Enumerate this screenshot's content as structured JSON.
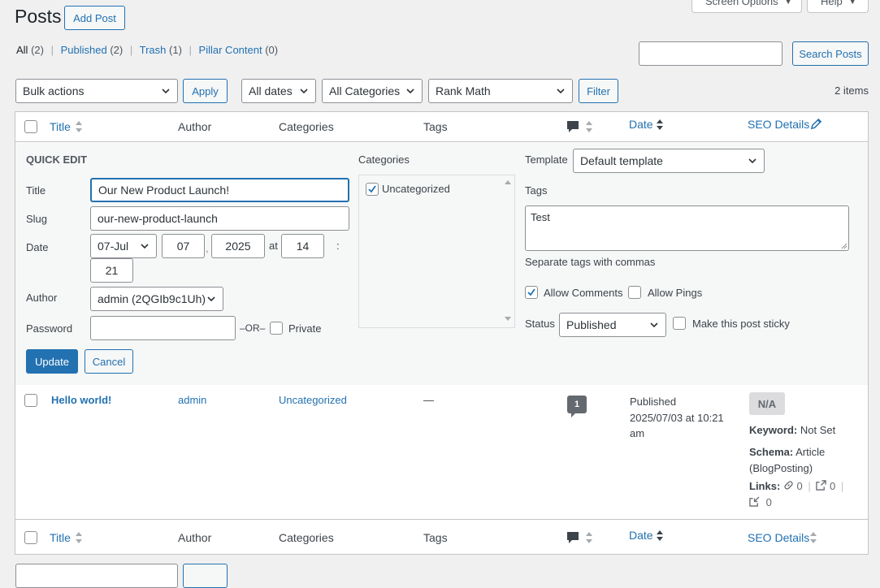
{
  "page": {
    "title": "Posts",
    "add_post": "Add Post",
    "screen_options": "Screen Options",
    "help": "Help"
  },
  "filters_links": {
    "all": "All",
    "all_count": "(2)",
    "published": "Published",
    "published_count": "(2)",
    "trash": "Trash",
    "trash_count": "(1)",
    "pillar": "Pillar Content",
    "pillar_count": "(0)",
    "sep": "|"
  },
  "search": {
    "value": "",
    "button": "Search Posts"
  },
  "toolbar": {
    "bulk_actions": "Bulk actions",
    "apply": "Apply",
    "dates": "All dates",
    "categories": "All Categories",
    "rank_math": "Rank Math",
    "filter": "Filter",
    "items": "2 items"
  },
  "columns": {
    "title": "Title",
    "author": "Author",
    "categories": "Categories",
    "tags": "Tags",
    "date": "Date",
    "seo": "SEO Details"
  },
  "quick_edit": {
    "heading": "QUICK EDIT",
    "title_label": "Title",
    "title_value": "Our New Product Launch!",
    "slug_label": "Slug",
    "slug_value": "our-new-product-launch",
    "date_label": "Date",
    "month": "07-Jul",
    "day": "07",
    "comma": ",",
    "year": "2025",
    "at": "at",
    "hour": "14",
    "colon": ":",
    "minute": "21",
    "author_label": "Author",
    "author_value": "admin (2QGIb9c1Uh)",
    "password_label": "Password",
    "password_value": "",
    "or": "–OR–",
    "private": "Private",
    "categories_label": "Categories",
    "category_item": "Uncategorized",
    "template_label": "Template",
    "template_value": "Default template",
    "tags_label": "Tags",
    "tags_value": "Test",
    "tags_hint": "Separate tags with commas",
    "allow_comments": "Allow Comments",
    "allow_pings": "Allow Pings",
    "status_label": "Status",
    "status_value": "Published",
    "sticky": "Make this post sticky",
    "update": "Update",
    "cancel": "Cancel"
  },
  "row": {
    "title": "Hello world!",
    "author": "admin",
    "category": "Uncategorized",
    "tags": "—",
    "comments": "1",
    "date_status": "Published",
    "date_value": "2025/07/03 at 10:21",
    "date_ampm": "am",
    "seo_badge": "N/A",
    "keyword_label": "Keyword:",
    "keyword_value": "Not Set",
    "schema_label": "Schema:",
    "schema_value": "Article",
    "schema_sub": "(BlogPosting)",
    "links_label": "Links:",
    "links_internal": "0",
    "links_external": "0",
    "links_incoming": "0",
    "sep": "|"
  },
  "colors": {
    "accent": "#2271b1",
    "background": "#f0f0f1",
    "quick_edit_bg": "#f6f7f7",
    "text": "#3c434a"
  }
}
